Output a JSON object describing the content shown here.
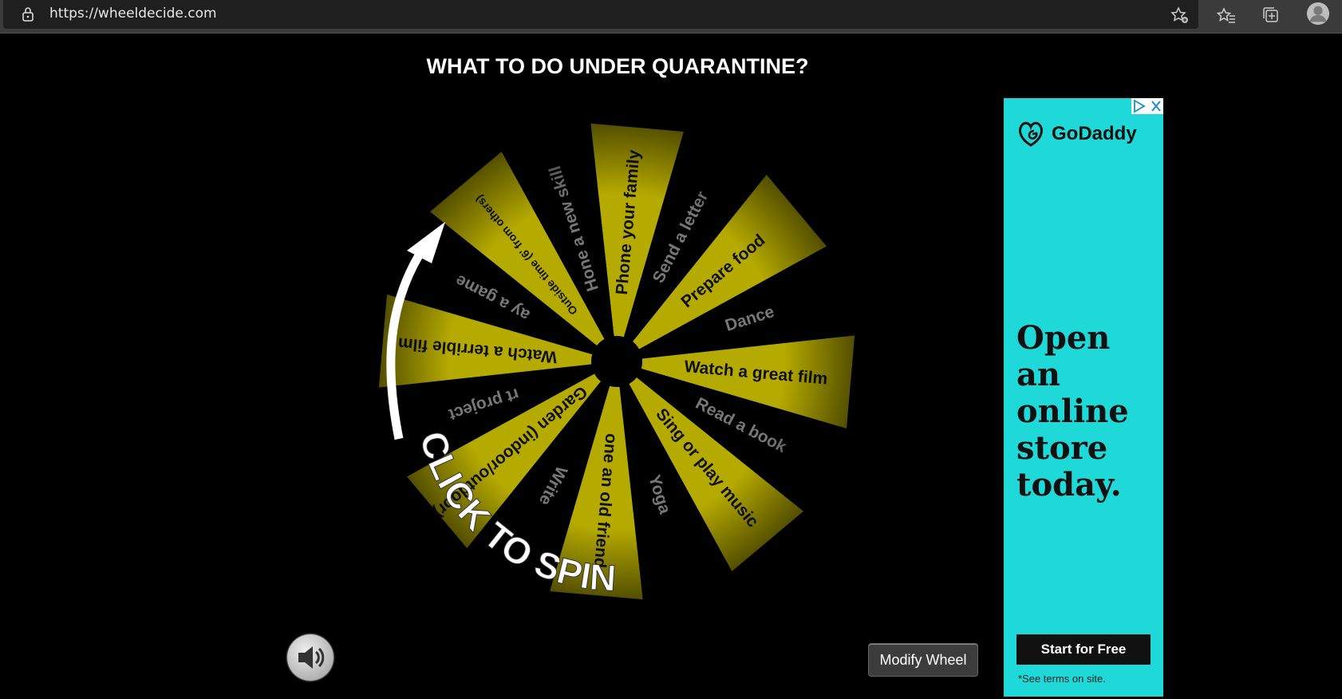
{
  "browser": {
    "url": "https://wheeldecide.com",
    "icons": [
      "lock-icon",
      "favorite-add-icon",
      "favorites-icon",
      "collections-icon",
      "profile-icon"
    ]
  },
  "page": {
    "title": "WHAT TO DO UNDER QUARANTINE?",
    "spin_label": "CLICK TO SPIN",
    "modify_label": "Modify Wheel",
    "sound_icon": "speaker-icon"
  },
  "wheel": {
    "colors": {
      "yellow": "#b5aa00",
      "black": "#000000"
    },
    "segments": [
      {
        "label": "Phone your family",
        "color": "yellow"
      },
      {
        "label": "Send a letter",
        "color": "black"
      },
      {
        "label": "Prepare food",
        "color": "yellow"
      },
      {
        "label": "Dance",
        "color": "black"
      },
      {
        "label": "Watch a great film",
        "color": "yellow"
      },
      {
        "label": "Read a book",
        "color": "black"
      },
      {
        "label": "Sing or play music",
        "color": "yellow"
      },
      {
        "label": "Yoga",
        "color": "black"
      },
      {
        "label": "one an old friend",
        "color": "yellow"
      },
      {
        "label": "Write",
        "color": "black"
      },
      {
        "label": "Garden (indoor/outdoor)",
        "color": "yellow"
      },
      {
        "label": "rt project",
        "color": "black"
      },
      {
        "label": "Watch a terrible film",
        "color": "yellow"
      },
      {
        "label": "ay a game",
        "color": "black"
      },
      {
        "label": "Outside time (6' from others)",
        "color": "yellow"
      },
      {
        "label": "Hone a new skill",
        "color": "black"
      }
    ]
  },
  "ad": {
    "brand": "GoDaddy",
    "headline": "Open an online store today.",
    "cta": "Start for Free",
    "terms": "*See terms on site.",
    "bg_color": "#1fd8d8"
  }
}
